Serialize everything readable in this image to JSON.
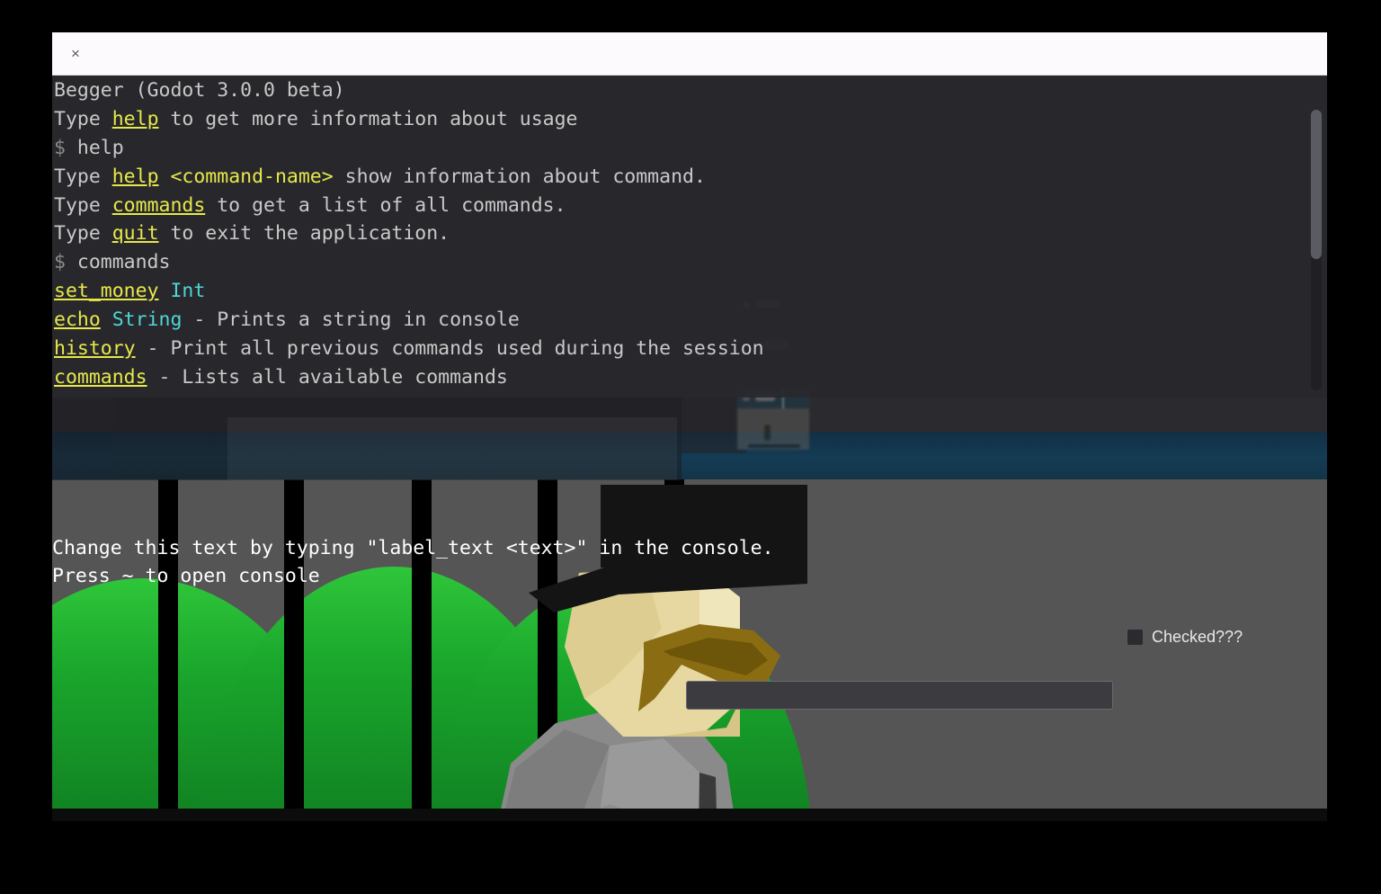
{
  "window": {
    "close_label": "×"
  },
  "console": {
    "header": "Begger (Godot 3.0.0 beta)",
    "lines": [
      {
        "id": "l0",
        "segments": [
          {
            "t": "Begger (Godot 3.0.0 beta)",
            "s": "plain"
          }
        ]
      },
      {
        "id": "l1",
        "segments": [
          {
            "t": "Type ",
            "s": "plain"
          },
          {
            "t": "help",
            "s": "kw"
          },
          {
            "t": " to get more information about usage",
            "s": "plain"
          }
        ]
      },
      {
        "id": "l2",
        "segments": [
          {
            "t": "$",
            "s": "prompt"
          },
          {
            "t": " help",
            "s": "plain"
          }
        ]
      },
      {
        "id": "l3",
        "segments": [
          {
            "t": "Type ",
            "s": "plain"
          },
          {
            "t": "help",
            "s": "kw"
          },
          {
            "t": " ",
            "s": "plain"
          },
          {
            "t": "<command-name>",
            "s": "kw-plain"
          },
          {
            "t": " show information about command.",
            "s": "plain"
          }
        ]
      },
      {
        "id": "l4",
        "segments": [
          {
            "t": "Type ",
            "s": "plain"
          },
          {
            "t": "commands",
            "s": "kw"
          },
          {
            "t": " to get a list of all commands.",
            "s": "plain"
          }
        ]
      },
      {
        "id": "l5",
        "segments": [
          {
            "t": "Type ",
            "s": "plain"
          },
          {
            "t": "quit",
            "s": "kw"
          },
          {
            "t": " to exit the application.",
            "s": "plain"
          }
        ]
      },
      {
        "id": "l6",
        "segments": [
          {
            "t": "$",
            "s": "prompt"
          },
          {
            "t": " commands",
            "s": "plain"
          }
        ]
      },
      {
        "id": "l7",
        "segments": [
          {
            "t": "set_money",
            "s": "kw"
          },
          {
            "t": " ",
            "s": "plain"
          },
          {
            "t": "Int",
            "s": "ty"
          }
        ]
      },
      {
        "id": "l8",
        "segments": [
          {
            "t": "echo",
            "s": "kw"
          },
          {
            "t": " ",
            "s": "plain"
          },
          {
            "t": "String",
            "s": "ty"
          },
          {
            "t": " - Prints a string in console",
            "s": "plain"
          }
        ]
      },
      {
        "id": "l9",
        "segments": [
          {
            "t": "history",
            "s": "kw"
          },
          {
            "t": " - Print all previous commands used during the session",
            "s": "plain"
          }
        ]
      },
      {
        "id": "l10",
        "segments": [
          {
            "t": "commands",
            "s": "kw"
          },
          {
            "t": " - Lists all available commands",
            "s": "plain"
          }
        ]
      }
    ],
    "colors": {
      "background": "#282830",
      "text": "#c9c9c9",
      "keyword": "#e7e84a",
      "type": "#4fd6d6",
      "prompt": "#8a8a8a"
    }
  },
  "hud": {
    "line1": "Change this text by typing \"label_text <text>\" in the console.",
    "line2": "Press ~ to open console",
    "checkbox_label": "Checked???",
    "checkbox_checked": false,
    "input_value": "",
    "input_placeholder": ""
  },
  "scene": {
    "background_color": "#555555",
    "sky_color": "#2b2b2f",
    "band_color": "#143a52",
    "hill_color_top": "#2fc63a",
    "hill_color_bottom": "#0f7a20",
    "bar_color": "#000000",
    "skin_color": "#e6d8a0",
    "coat_color": "#8a8a8a",
    "hat_color": "#141414",
    "mustache_color": "#8a6d12"
  },
  "scrollbar": {
    "thumb_color": "#5b5b63",
    "track_color": "#202024"
  }
}
